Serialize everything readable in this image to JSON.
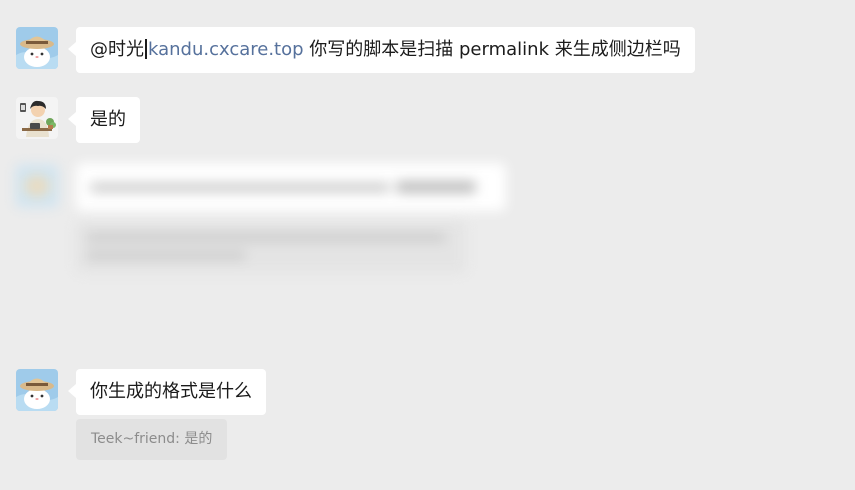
{
  "messages": [
    {
      "avatar": "cat-with-straw-hat-avatar",
      "mention": "@时光",
      "link": "kandu.cxcare.top",
      "text": " 你写的脚本是扫描 permalink 来生成侧边栏吗"
    },
    {
      "avatar": "cartoon-person-at-desk-avatar",
      "text": "是的"
    },
    {
      "avatar": "cat-with-straw-hat-avatar",
      "text": "你生成的格式是什么"
    }
  ],
  "quote": {
    "text": "Teek~friend: 是的"
  },
  "colors": {
    "background": "#ececec",
    "bubble": "#ffffff",
    "link": "#56719c",
    "quote_background": "#e2e2e2",
    "quote_text": "#8c8c8c"
  }
}
